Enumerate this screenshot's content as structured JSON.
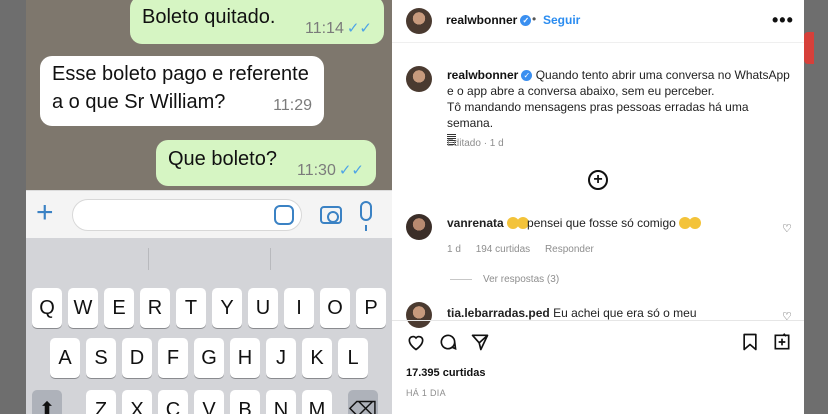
{
  "whatsapp": {
    "messages": [
      {
        "text": "Boleto quitado.",
        "time": "11:14",
        "ticks": "✓✓",
        "direction": "outgoing"
      },
      {
        "line1": "Esse boleto pago e referente",
        "line2": "a  o que Sr William?",
        "time": "11:29",
        "direction": "incoming"
      },
      {
        "text": "Que boleto?",
        "time": "11:30",
        "ticks": "✓✓",
        "direction": "outgoing"
      }
    ],
    "input": {
      "placeholder": ""
    },
    "icons": {
      "attach": "plus-icon",
      "sticker": "sticker-icon",
      "camera": "camera-icon",
      "mic": "microphone-icon"
    },
    "keyboard": {
      "row1": [
        "Q",
        "W",
        "E",
        "R",
        "T",
        "Y",
        "U",
        "I",
        "O",
        "P"
      ],
      "row2": [
        "A",
        "S",
        "D",
        "F",
        "G",
        "H",
        "J",
        "K",
        "L"
      ],
      "row3": [
        "Z",
        "X",
        "C",
        "V",
        "B",
        "N",
        "M"
      ],
      "shift": "⬆",
      "delete": "⌫"
    },
    "colors": {
      "outgoing_bubble": "#d6f5c3",
      "incoming_bubble": "#ffffff",
      "ticks": "#4ea4e6",
      "accent": "#3b82c4"
    }
  },
  "instagram": {
    "header": {
      "username": "realwbonner",
      "separator": "•",
      "follow": "Seguir",
      "more": "•••"
    },
    "caption": {
      "username": "realwbonner",
      "text1": "Quando tento abrir uma conversa no WhatsApp",
      "text2": "e o app abre a conversa abaixo, sem eu perceber.",
      "text3": "Tô mandando mensagens pras pessoas erradas há uma semana.",
      "edited": "Editado · 1 d"
    },
    "comments": [
      {
        "username": "vanrenata",
        "text": "pensei que fosse só comigo",
        "age": "1 d",
        "likes": "194 curtidas",
        "reply": "Responder",
        "view_replies": "Ver respostas (3)"
      },
      {
        "username": "tia.lebarradas.ped",
        "text": "Eu achei que era só o meu"
      }
    ],
    "likes": "17.395 curtidas",
    "posted": "HÁ 1 DIA",
    "icons": [
      "heart-icon",
      "comment-icon",
      "share-icon",
      "bookmark-icon",
      "add-post-icon"
    ],
    "colors": {
      "link": "#2a8cf0",
      "verified": "#3a8ff0",
      "muted": "#8e8e8e"
    }
  }
}
